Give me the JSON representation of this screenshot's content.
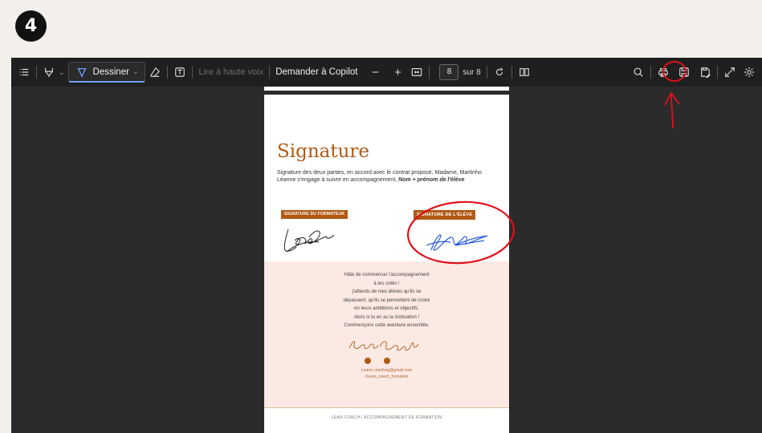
{
  "step": "4",
  "toolbar": {
    "draw_label": "Dessiner",
    "read_aloud": "Lire à haute voix",
    "copilot": "Demander à Copilot",
    "zoom_out": "−",
    "zoom_in": "+",
    "page_current": "8",
    "page_total": "sur 8",
    "icons": [
      "contents-icon",
      "highlight-icon",
      "draw-icon",
      "eraser-icon",
      "text-icon",
      "fit-page-icon",
      "rotate-icon",
      "page-view-icon",
      "search-icon",
      "print-icon",
      "save-icon",
      "save-as-icon",
      "fullscreen-icon",
      "settings-icon"
    ]
  },
  "document": {
    "title": "Signature",
    "intro_plain": "Signature des deux parties, en accord avec le contrat proposé, Madame, Martinho Léanne s'engage à suivre en accompagnement,",
    "intro_bold": "Nom + prénom de l'élève",
    "tag_trainer": "SIGNATURE DU FORMATEUR",
    "tag_student": "SIGNATURE DE L'ÉLÈVE",
    "closing_lines": [
      "Hâte de commencer l'accompagnement",
      "à tes cotés !",
      "j'attends de mes élèves qu'ils se",
      "dépassent, qu'ils se permettent de croire",
      "en leurs ambitions et objectifs.",
      "Alors si tu en as la motivation !",
      "Commençons cette aventure ensemble."
    ],
    "email": "Leane.coaching@gmail.com",
    "instagram": "#Lean_coach_formation",
    "footer": "LEAN COACH | ACCOMPAGNEMENT DE FORMATION"
  },
  "colors": {
    "accent": "#b05a14",
    "annotation": "#e0101a",
    "ink_blue": "#2d5fd8"
  }
}
